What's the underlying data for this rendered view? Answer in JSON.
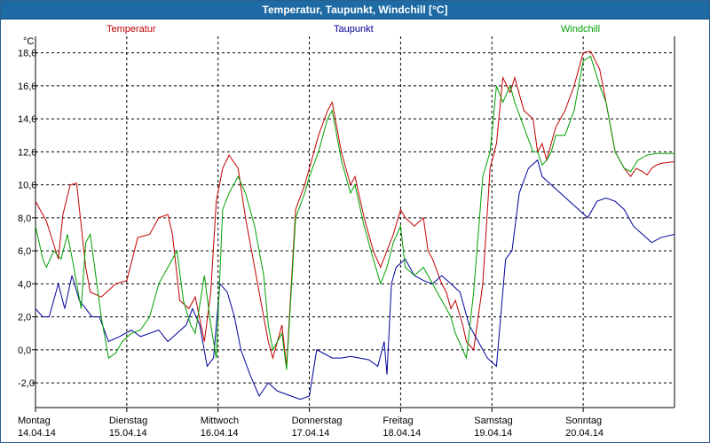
{
  "window": {
    "title": "Temperatur, Taupunkt, Windchill [°C]"
  },
  "chart_data": {
    "type": "line",
    "title": "Temperatur, Taupunkt, Windchill [°C]",
    "ylabel": "°C",
    "ylim": [
      -3.5,
      19
    ],
    "xlim": [
      0,
      7
    ],
    "y_ticks": [
      -2,
      0,
      2,
      4,
      6,
      8,
      10,
      12,
      14,
      16,
      18
    ],
    "y_tick_labels": [
      "-2,0",
      "0,0",
      "2,0",
      "4,0",
      "6,0",
      "8,0",
      "10,0",
      "12,0",
      "14,0",
      "16,0",
      "18,0"
    ],
    "grid": true,
    "x_ticks": [
      {
        "day": "Montag",
        "date": "14.04.14"
      },
      {
        "day": "Dienstag",
        "date": "15.04.14"
      },
      {
        "day": "Mittwoch",
        "date": "16.04.14"
      },
      {
        "day": "Donnerstag",
        "date": "17.04.14"
      },
      {
        "day": "Freitag",
        "date": "18.04.14"
      },
      {
        "day": "Samstag",
        "date": "19.04.14"
      },
      {
        "day": "Sonntag",
        "date": "20.04.14"
      }
    ],
    "series": [
      {
        "name": "Temperatur",
        "color": "#c00000",
        "x": [
          0,
          0.12,
          0.25,
          0.3,
          0.38,
          0.45,
          0.55,
          0.6,
          0.72,
          0.8,
          0.88,
          1.0,
          1.12,
          1.25,
          1.35,
          1.45,
          1.5,
          1.58,
          1.68,
          1.75,
          1.85,
          1.92,
          1.98,
          2.05,
          2.12,
          2.22,
          2.3,
          2.4,
          2.5,
          2.55,
          2.6,
          2.7,
          2.75,
          2.85,
          2.95,
          3.0,
          3.1,
          3.2,
          3.25,
          3.35,
          3.45,
          3.5,
          3.6,
          3.7,
          3.78,
          3.85,
          3.92,
          4.0,
          4.05,
          4.15,
          4.25,
          4.3,
          4.35,
          4.45,
          4.5,
          4.55,
          4.6,
          4.68,
          4.72,
          4.8,
          4.9,
          4.98,
          5.05,
          5.12,
          5.2,
          5.25,
          5.35,
          5.45,
          5.5,
          5.55,
          5.6,
          5.65,
          5.7,
          5.8,
          5.9,
          6.0,
          6.08,
          6.18,
          6.25,
          6.35,
          6.45,
          6.52,
          6.58,
          6.65,
          6.7,
          6.75,
          6.8,
          6.85,
          7.0
        ],
        "y": [
          9.0,
          7.8,
          5.5,
          8.2,
          10.0,
          10.1,
          5.0,
          3.5,
          3.2,
          3.6,
          4.0,
          4.2,
          6.8,
          7.0,
          8.0,
          8.2,
          7.0,
          3.0,
          2.5,
          3.2,
          0.5,
          3.5,
          9.0,
          11.0,
          11.8,
          11.0,
          8.0,
          5.0,
          2.0,
          0.5,
          -0.5,
          1.5,
          -1.0,
          8.5,
          10.0,
          11.0,
          13.0,
          14.5,
          15.0,
          12.0,
          10.0,
          10.5,
          8.0,
          6.0,
          5.0,
          6.0,
          7.0,
          8.5,
          8.0,
          7.5,
          8.0,
          6.0,
          5.5,
          4.0,
          3.5,
          2.5,
          3.0,
          1.5,
          0.5,
          0.0,
          4.0,
          11.0,
          12.5,
          16.5,
          15.6,
          16.5,
          14.5,
          14.0,
          12.0,
          12.5,
          11.5,
          12.5,
          13.5,
          14.5,
          16.0,
          18.0,
          18.1,
          17.0,
          15.0,
          12.0,
          11.0,
          10.5,
          11.0,
          10.8,
          10.6,
          11.0,
          11.2,
          11.3,
          11.4
        ]
      },
      {
        "name": "Taupunkt",
        "color": "#00009a",
        "x": [
          0,
          0.08,
          0.15,
          0.25,
          0.32,
          0.4,
          0.48,
          0.55,
          0.62,
          0.7,
          0.8,
          0.92,
          1.05,
          1.15,
          1.25,
          1.35,
          1.45,
          1.55,
          1.65,
          1.72,
          1.8,
          1.88,
          1.95,
          2.02,
          2.1,
          2.18,
          2.25,
          2.35,
          2.45,
          2.55,
          2.65,
          2.8,
          2.9,
          3.0,
          3.08,
          3.15,
          3.25,
          3.35,
          3.45,
          3.55,
          3.65,
          3.75,
          3.82,
          3.85,
          3.9,
          3.95,
          4.05,
          4.15,
          4.25,
          4.35,
          4.45,
          4.55,
          4.65,
          4.75,
          4.85,
          4.95,
          5.05,
          5.15,
          5.22,
          5.3,
          5.4,
          5.5,
          5.55,
          5.65,
          5.75,
          5.85,
          5.95,
          6.05,
          6.15,
          6.25,
          6.35,
          6.45,
          6.55,
          6.65,
          6.75,
          6.85,
          7.0
        ],
        "y": [
          2.5,
          2.0,
          2.0,
          4.0,
          2.5,
          4.5,
          3.0,
          2.5,
          2.0,
          2.0,
          0.5,
          0.8,
          1.2,
          0.8,
          1.0,
          1.2,
          0.5,
          1.0,
          1.5,
          2.5,
          1.5,
          -1.0,
          -0.5,
          4.0,
          3.5,
          2.0,
          0.0,
          -1.5,
          -2.8,
          -2.0,
          -2.5,
          -2.8,
          -3.0,
          -2.8,
          0.0,
          -0.2,
          -0.5,
          -0.5,
          -0.4,
          -0.5,
          -0.6,
          -1.0,
          0.5,
          -1.5,
          4.0,
          5.0,
          5.5,
          4.5,
          4.2,
          4.0,
          4.5,
          4.0,
          3.5,
          1.5,
          0.5,
          -0.5,
          -1.0,
          5.5,
          6.0,
          9.5,
          11.0,
          11.5,
          10.5,
          10.0,
          9.5,
          9.0,
          8.5,
          8.0,
          9.0,
          9.2,
          9.0,
          8.5,
          7.5,
          7.0,
          6.5,
          6.8,
          7.0
        ]
      },
      {
        "name": "Windchill",
        "color": "#00a000",
        "x": [
          0,
          0.08,
          0.12,
          0.2,
          0.28,
          0.35,
          0.42,
          0.5,
          0.55,
          0.6,
          0.72,
          0.8,
          0.88,
          0.95,
          1.05,
          1.15,
          1.25,
          1.35,
          1.45,
          1.55,
          1.62,
          1.7,
          1.75,
          1.85,
          1.92,
          1.98,
          2.05,
          2.12,
          2.22,
          2.3,
          2.4,
          2.5,
          2.55,
          2.6,
          2.7,
          2.75,
          2.85,
          2.95,
          3.0,
          3.1,
          3.2,
          3.25,
          3.35,
          3.45,
          3.5,
          3.6,
          3.7,
          3.78,
          3.85,
          3.92,
          4.0,
          4.05,
          4.15,
          4.25,
          4.3,
          4.35,
          4.45,
          4.5,
          4.55,
          4.6,
          4.68,
          4.72,
          4.8,
          4.9,
          4.98,
          5.05,
          5.12,
          5.2,
          5.25,
          5.35,
          5.45,
          5.5,
          5.55,
          5.6,
          5.65,
          5.7,
          5.8,
          5.9,
          6.0,
          6.08,
          6.18,
          6.25,
          6.35,
          6.45,
          6.52,
          6.6,
          6.7,
          6.8,
          6.85,
          7.0
        ],
        "y": [
          7.5,
          5.5,
          5.0,
          6.0,
          5.5,
          7.0,
          5.0,
          2.5,
          6.5,
          7.0,
          2.0,
          -0.5,
          -0.2,
          0.5,
          1.0,
          1.2,
          2.0,
          4.0,
          5.0,
          6.0,
          3.0,
          1.5,
          1.0,
          4.5,
          1.5,
          -0.5,
          8.5,
          9.5,
          10.5,
          9.5,
          7.5,
          4.5,
          1.5,
          0.0,
          1.0,
          -1.2,
          8.0,
          9.5,
          10.5,
          12.0,
          14.0,
          14.5,
          11.5,
          9.5,
          10.0,
          7.5,
          5.5,
          4.0,
          5.0,
          6.5,
          7.5,
          5.0,
          4.5,
          5.0,
          4.5,
          4.0,
          3.0,
          2.5,
          2.0,
          1.0,
          0.0,
          -0.5,
          3.5,
          10.5,
          12.0,
          16.0,
          15.0,
          16.0,
          15.0,
          13.5,
          12.0,
          12.0,
          11.2,
          11.5,
          12.0,
          13.0,
          13.0,
          14.5,
          17.5,
          17.8,
          16.0,
          15.0,
          12.0,
          11.0,
          10.8,
          11.5,
          11.8,
          11.9,
          11.9,
          11.9
        ]
      }
    ]
  }
}
